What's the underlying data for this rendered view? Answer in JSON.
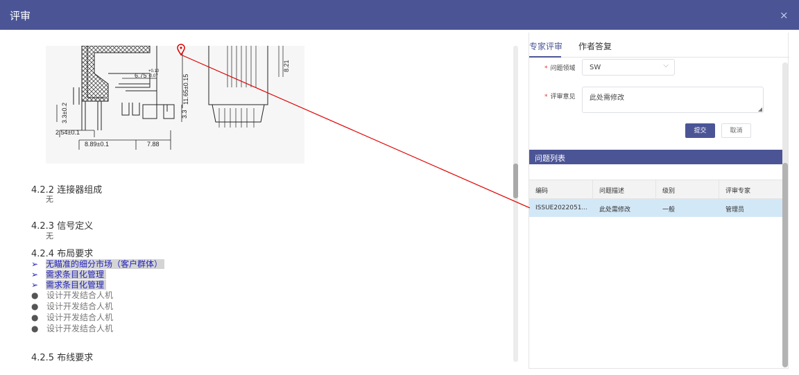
{
  "dialog": {
    "title": "评审",
    "close_glyph": "×"
  },
  "document": {
    "drawing": {
      "labels": [
        "6.75",
        "+0.10",
        "-0.07",
        "11.65±0.15",
        "8.21",
        "3.3±0.2",
        "2.54±0.1",
        "8.89±0.1",
        "7.88",
        "3.3"
      ]
    },
    "sections": [
      {
        "heading": "4.2.2 连接器组成",
        "body": "无"
      },
      {
        "heading": "4.2.3 信号定义",
        "body": "无"
      },
      {
        "heading": "4.2.4 布局要求",
        "body": ""
      },
      {
        "heading": "4.2.5 布线要求",
        "body": ""
      }
    ],
    "highlight_bullet_glyph": "➢",
    "highlighted_items": [
      "无瞄准的细分市场（客户群体）",
      "需求条目化管理",
      "需求条目化管理"
    ],
    "dot_bullet_glyph": "●",
    "dot_items": [
      "设计开发结合人机",
      "设计开发结合人机",
      "设计开发结合人机",
      "设计开发结合人机"
    ]
  },
  "review_panel": {
    "tabs": [
      {
        "label": "专家评审",
        "active": true
      },
      {
        "label": "作者答复",
        "active": false
      }
    ],
    "form": {
      "required_mark": "*",
      "domain_label": "问题领域",
      "domain_value": "SW",
      "opinion_label": "评审意见",
      "opinion_value": "此处需修改",
      "submit_label": "提交",
      "cancel_label": "取消"
    },
    "issue_list": {
      "title": "问题列表",
      "columns": [
        "编码",
        "问题描述",
        "级别",
        "评审专家"
      ],
      "rows": [
        [
          "ISSUE2022051...",
          "此处需修改",
          "一般",
          "管理员"
        ]
      ]
    }
  },
  "colors": {
    "accent": "#4b5596",
    "annotation_line": "#e00000",
    "row_selected": "#d3e8f7",
    "highlight_text": "#2222bb"
  }
}
